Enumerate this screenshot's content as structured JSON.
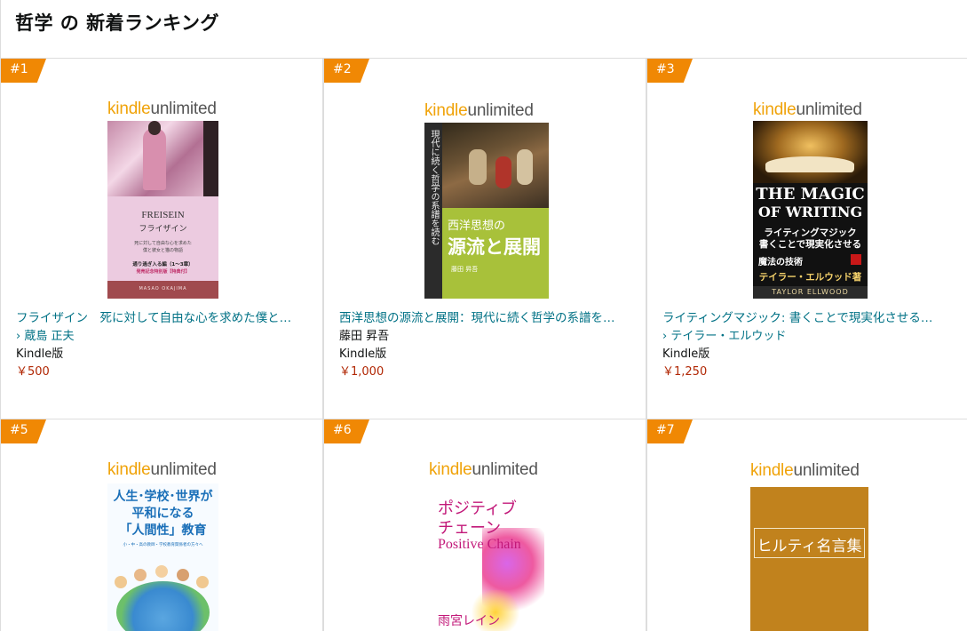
{
  "header": {
    "title": "哲学 の 新着ランキング"
  },
  "brand": {
    "kindle": "kindle",
    "unlimited": "unlimited"
  },
  "colors": {
    "rank_badge": "#f08804",
    "link": "#007185",
    "price": "#B12704"
  },
  "items": [
    {
      "rank": "#1",
      "title": "フライザイン　死に対して自由な心を求めた僕と…",
      "author": "蔵島 正夫",
      "author_link": true,
      "format": "Kindle版",
      "price": "￥500",
      "cover": {
        "en_title": "FREISEIN",
        "jp_title": "フライザイン",
        "sub1": "死に対して自由な心を求めた",
        "sub2": "僕と彼女と猫の物語",
        "series": "通り過ぎ入る編（1〜3章）",
        "promo": "発売記念特別版【特典付】",
        "author_en": "MASAO OKAJIMA"
      }
    },
    {
      "rank": "#2",
      "title": "西洋思想の源流と展開：現代に続く哲学の系譜を…",
      "author": "藤田 昇吾",
      "author_link": false,
      "format": "Kindle版",
      "price": "￥1,000",
      "cover": {
        "vertical": "現代に続く哲学の系譜を読む",
        "title_small": "西洋思想の",
        "title_big": "源流と展開",
        "author": "藤田 昇吾"
      }
    },
    {
      "rank": "#3",
      "title": "ライティングマジック: 書くことで現実化させる…",
      "author": "テイラー・エルウッド",
      "author_link": true,
      "format": "Kindle版",
      "price": "￥1,250",
      "cover": {
        "en1": "THE MAGIC",
        "en2": "OF WRITING",
        "jp1": "ライティングマジック",
        "jp2": "書くことで現実化させる",
        "jp3": "魔法の技術",
        "jp_author": "テイラー・エルウッド著",
        "en_author": "TAYLOR ELLWOOD"
      }
    },
    {
      "rank": "#5",
      "cover": {
        "line1": "人生･学校･世界が",
        "line2": "平和になる",
        "line3": "「人間性」教育",
        "sub": "小・中・高の教師・学校教育関係者の方々へ"
      }
    },
    {
      "rank": "#6",
      "cover": {
        "line1": "ポジティブ",
        "line2": "チェーン",
        "en": "Positive Chain",
        "author": "雨宮レイン"
      }
    },
    {
      "rank": "#7",
      "cover": {
        "title": "ヒルティ名言集"
      }
    }
  ]
}
